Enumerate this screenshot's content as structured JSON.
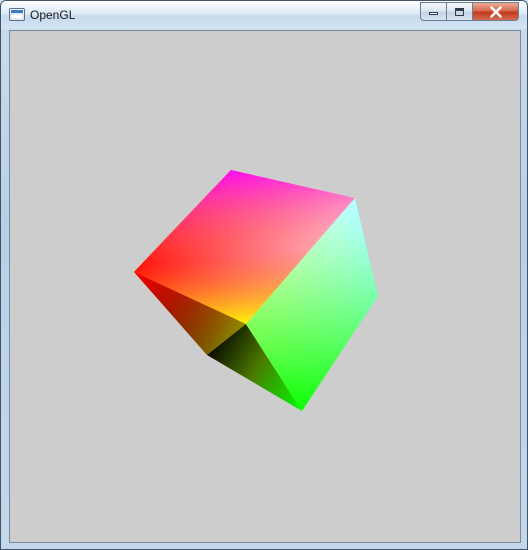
{
  "window": {
    "title": "OpenGL",
    "icon": "opengl-app-icon",
    "controls": {
      "minimize_icon": "minimize-icon",
      "maximize_icon": "maximize-icon",
      "close_icon": "close-icon"
    }
  },
  "viewport": {
    "background_color": "#cdcdcd",
    "object": "rgb-color-cube"
  }
}
